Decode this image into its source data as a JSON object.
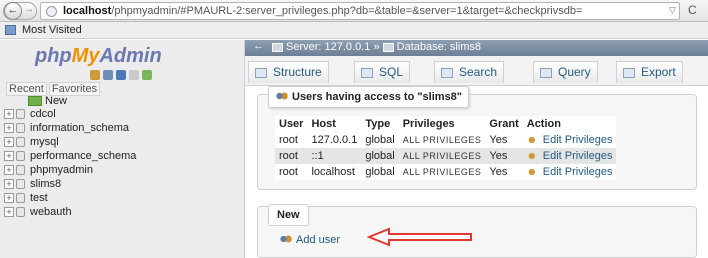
{
  "browser": {
    "back_glyph": "←",
    "forward_glyph": "→",
    "url_host": "localhost",
    "url_rest": "/phpmyadmin/#PMAURL-2:server_privileges.php?db=&table=&server=1&target=&checkprivsdb=",
    "reload_glyph": "C",
    "bookmark_label": "Most Visited"
  },
  "nav": {
    "logo_php": "php",
    "logo_my": "My",
    "logo_admin": "Admin",
    "tab_recent": "Recent",
    "tab_favorites": "Favorites",
    "new_label": "New",
    "databases": [
      "cdcol",
      "information_schema",
      "mysql",
      "performance_schema",
      "phpmyadmin",
      "slims8",
      "test",
      "webauth"
    ]
  },
  "main": {
    "breadcrumb_server": "Server: 127.0.0.1",
    "breadcrumb_sep": "»",
    "breadcrumb_db": "Database: slims8",
    "tabs": [
      "Structure",
      "SQL",
      "Search",
      "Query",
      "Export"
    ],
    "users_legend": "Users having access to \"slims8\"",
    "table": {
      "headers": [
        "User",
        "Host",
        "Type",
        "Privileges",
        "Grant",
        "Action"
      ],
      "rows": [
        [
          "root",
          "127.0.0.1",
          "global",
          "ALL PRIVILEGES",
          "Yes",
          "Edit Privileges"
        ],
        [
          "root",
          "::1",
          "global",
          "ALL PRIVILEGES",
          "Yes",
          "Edit Privileges"
        ],
        [
          "root",
          "localhost",
          "global",
          "ALL PRIVILEGES",
          "Yes",
          "Edit Privileges"
        ]
      ]
    },
    "new_legend": "New",
    "add_user_label": "Add user"
  },
  "colors": {
    "link": "#235a81",
    "arrow": "#e03a2f",
    "topbar": "#7f90a6"
  }
}
